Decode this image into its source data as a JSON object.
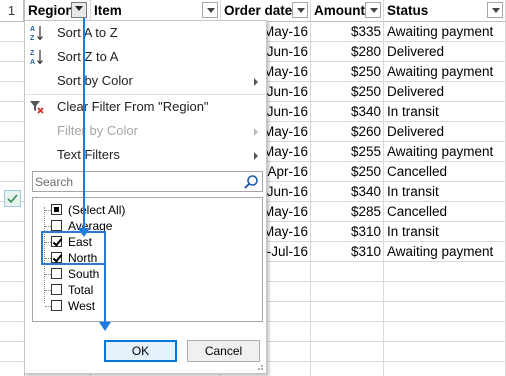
{
  "sheet": {
    "header_row_number": "1",
    "columns": [
      {
        "key": "region",
        "label": "Region",
        "filter_active": true
      },
      {
        "key": "item",
        "label": "Item",
        "filter_active": false
      },
      {
        "key": "order_date",
        "label": "Order date",
        "filter_active": false
      },
      {
        "key": "amount",
        "label": "Amount",
        "filter_active": false
      },
      {
        "key": "status",
        "label": "Status",
        "filter_active": false
      }
    ],
    "rows": [
      {
        "date": "May-16",
        "amount": "$335",
        "status": "Awaiting payment"
      },
      {
        "date": "Jun-16",
        "amount": "$280",
        "status": "Delivered"
      },
      {
        "date": "May-16",
        "amount": "$250",
        "status": "Awaiting payment"
      },
      {
        "date": "Jun-16",
        "amount": "$250",
        "status": "Delivered"
      },
      {
        "date": "Jun-16",
        "amount": "$340",
        "status": "In transit"
      },
      {
        "date": "May-16",
        "amount": "$260",
        "status": "Delivered"
      },
      {
        "date": "May-16",
        "amount": "$255",
        "status": "Awaiting payment"
      },
      {
        "date": "Apr-16",
        "amount": "$250",
        "status": "Cancelled"
      },
      {
        "date": "Jun-16",
        "amount": "$340",
        "status": "In transit"
      },
      {
        "date": "May-16",
        "amount": "$285",
        "status": "Cancelled"
      },
      {
        "date": "May-16",
        "amount": "$310",
        "status": "In transit"
      },
      {
        "date": "-Jul-16",
        "amount": "$310",
        "status": "Awaiting payment"
      }
    ]
  },
  "menu": {
    "sort_a_to_z": "Sort A to Z",
    "sort_z_to_a": "Sort Z to A",
    "sort_by_color": "Sort by Color",
    "clear_filter": "Clear Filter From \"Region\"",
    "filter_by_color": "Filter by Color",
    "text_filters": "Text Filters",
    "search_placeholder": "Search",
    "list": [
      {
        "label": "(Select All)",
        "state": "partial"
      },
      {
        "label": "Average",
        "state": "unchecked"
      },
      {
        "label": "East",
        "state": "checked"
      },
      {
        "label": "North",
        "state": "checked"
      },
      {
        "label": "South",
        "state": "unchecked"
      },
      {
        "label": "Total",
        "state": "unchecked"
      },
      {
        "label": "West",
        "state": "unchecked"
      }
    ],
    "ok_label": "OK",
    "cancel_label": "Cancel"
  },
  "colors": {
    "accent_blue": "#1e7be0",
    "ok_border": "#0078d7",
    "header_bg": "#f2f2f2",
    "gridline": "#d9d9d9"
  },
  "icons": {
    "sort_az": "sort-ascending-icon",
    "sort_za": "sort-descending-icon",
    "clear_filter": "clear-filter-icon",
    "search": "search-icon",
    "filter_dropdown": "filter-dropdown-icon"
  }
}
